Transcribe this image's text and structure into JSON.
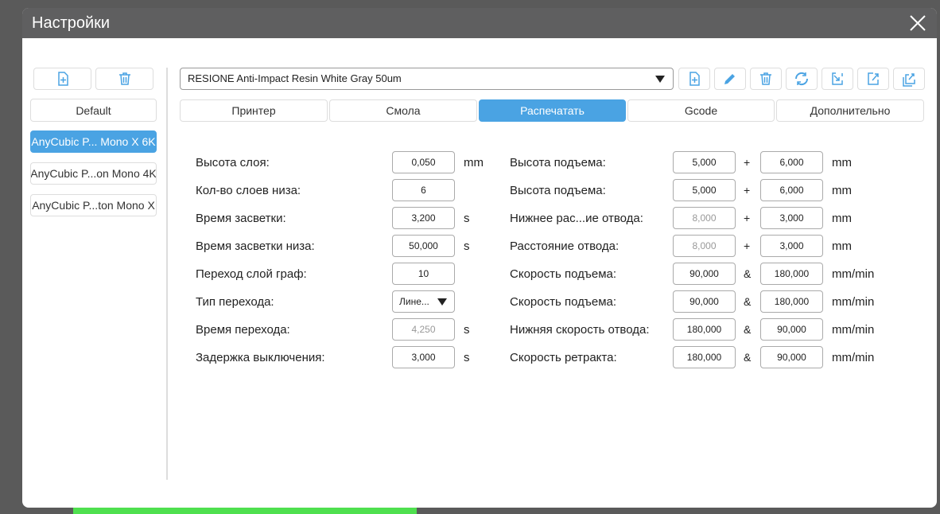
{
  "title": "Настройки",
  "colors": {
    "accent": "#4aa3e3",
    "titlebar": "#5f5f60"
  },
  "sidebar": {
    "buttons": [
      {
        "icon": "file-add-icon"
      },
      {
        "icon": "trash-icon"
      }
    ],
    "default_label": "Default",
    "printers": [
      "AnyCubic P... Mono X 6K",
      "AnyCubic P...on Mono 4K",
      "AnyCubic P...ton Mono X"
    ],
    "selected_index": 0
  },
  "profile": {
    "selected": "RESIONE Anti-Impact Resin White Gray 50um"
  },
  "toolbar_icons": [
    "file-add-icon",
    "pencil-icon",
    "trash-icon",
    "refresh-icon",
    "import-icon",
    "export-icon",
    "export-all-icon"
  ],
  "tabs": [
    "Принтер",
    "Смола",
    "Распечатать",
    "Gcode",
    "Дополнительно"
  ],
  "active_tab": 2,
  "left_fields": [
    {
      "label": "Высота слоя:",
      "value": "0,050",
      "unit": "mm"
    },
    {
      "label": "Кол-во слоев низа:",
      "value": "6",
      "unit": ""
    },
    {
      "label": "Время засветки:",
      "value": "3,200",
      "unit": "s"
    },
    {
      "label": "Время засветки низа:",
      "value": "50,000",
      "unit": "s"
    },
    {
      "label": "Переход слой граф:",
      "value": "10",
      "unit": ""
    },
    {
      "label": "Тип перехода:",
      "value": "Лине...",
      "unit": ""
    },
    {
      "label": "Время перехода:",
      "value": "4,250",
      "unit": "s",
      "disabled": true
    },
    {
      "label": "Задержка выключения:",
      "value": "3,000",
      "unit": "s"
    }
  ],
  "right_fields": [
    {
      "label": "Высота подъема:",
      "v1": "5,000",
      "op": "+",
      "v2": "6,000",
      "unit": "mm"
    },
    {
      "label": "Высота подъема:",
      "v1": "5,000",
      "op": "+",
      "v2": "6,000",
      "unit": "mm"
    },
    {
      "label": "Нижнее рас...ие отвода:",
      "v1": "8,000",
      "op": "+",
      "v2": "3,000",
      "unit": "mm",
      "v1_disabled": true
    },
    {
      "label": "Расстояние отвода:",
      "v1": "8,000",
      "op": "+",
      "v2": "3,000",
      "unit": "mm",
      "v1_disabled": true
    },
    {
      "label": "Скорость подъема:",
      "v1": "90,000",
      "op": "&",
      "v2": "180,000",
      "unit": "mm/min"
    },
    {
      "label": "Скорость подъема:",
      "v1": "90,000",
      "op": "&",
      "v2": "180,000",
      "unit": "mm/min"
    },
    {
      "label": "Нижняя скорость отвода:",
      "v1": "180,000",
      "op": "&",
      "v2": "90,000",
      "unit": "mm/min"
    },
    {
      "label": "Скорость ретракта:",
      "v1": "180,000",
      "op": "&",
      "v2": "90,000",
      "unit": "mm/min"
    }
  ]
}
